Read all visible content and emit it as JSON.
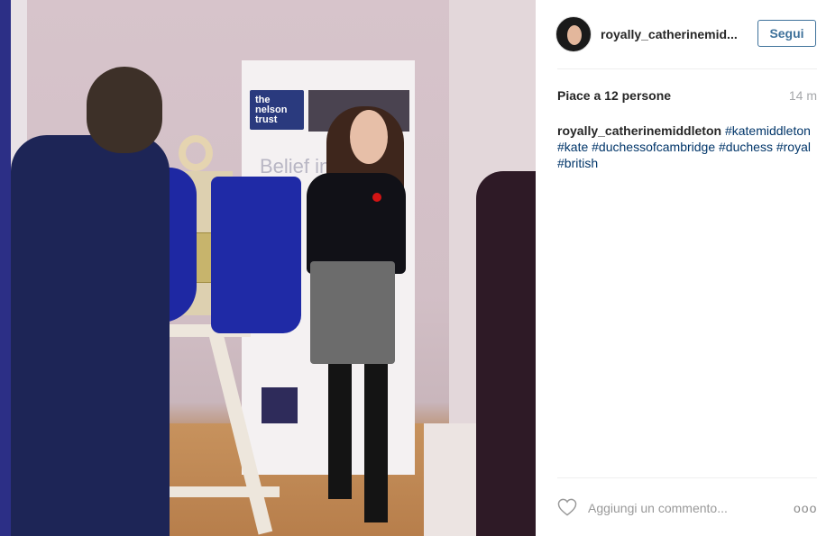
{
  "post": {
    "username": "royally_catherinemid...",
    "follow_label": "Segui",
    "likes": "Piace a 12 persone",
    "time": "14 m",
    "caption_user": "royally_catherinemiddleton",
    "hashtags": [
      "#katemiddleton",
      "#kate",
      "#duchessofcambridge",
      "#duchess",
      "#royal",
      "#british"
    ],
    "comment_placeholder": "Aggiungi un commento...",
    "more_label": "ooo"
  },
  "photo": {
    "banner_logo": "the nelson trust",
    "banner_text": "Belief in"
  },
  "colors": {
    "link": "#003569",
    "follow": "#3f729b",
    "muted": "#a5a7aa"
  },
  "icons": [
    "heart-icon",
    "more-options-icon"
  ]
}
